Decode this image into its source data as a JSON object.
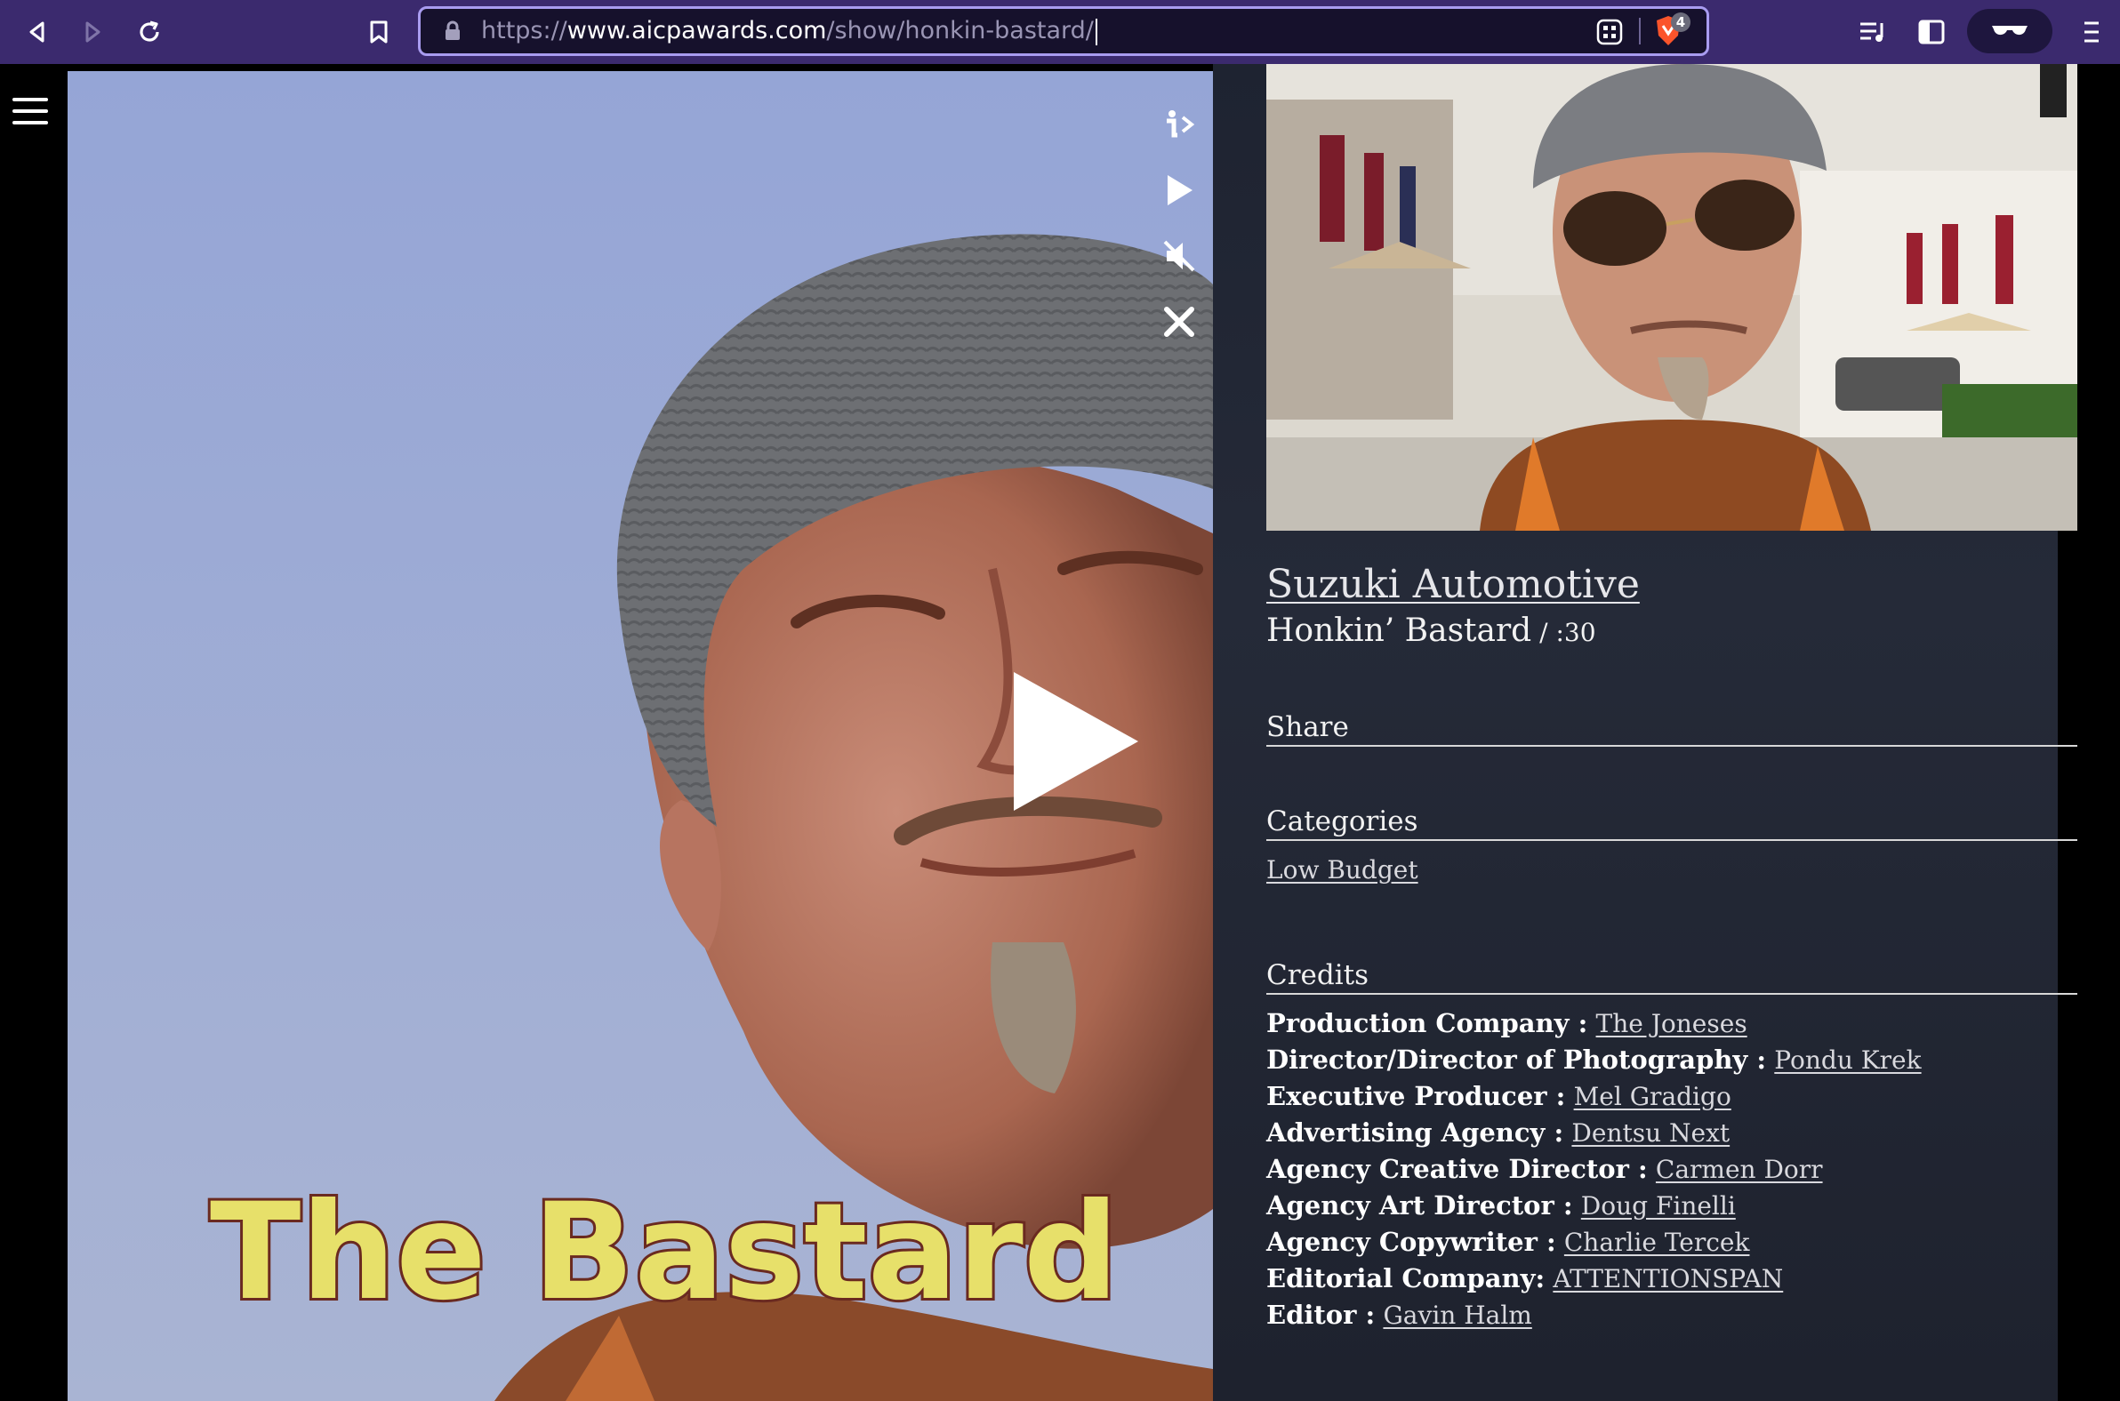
{
  "browser": {
    "url_prefix": "https://",
    "url_domain": "www.aicpawards.com",
    "url_path": "/show/honkin-bastard/",
    "shields_count": "4"
  },
  "video": {
    "caption": "The Bastard"
  },
  "spot": {
    "client": "Suzuki Automotive",
    "title": "Honkin’ Bastard",
    "duration": " / :30"
  },
  "sections": {
    "share": "Share",
    "categories": "Categories",
    "credits": "Credits"
  },
  "categories": [
    "Low Budget"
  ],
  "credits": [
    {
      "role": "Production Company :",
      "name": "The Joneses"
    },
    {
      "role": "Director/Director of Photography :",
      "name": "Pondu Krek"
    },
    {
      "role": "Executive Producer :",
      "name": "Mel Gradigo"
    },
    {
      "role": "Advertising Agency :",
      "name": "Dentsu Next"
    },
    {
      "role": "Agency Creative Director :",
      "name": "Carmen Dorr"
    },
    {
      "role": "Agency Art Director :",
      "name": "Doug Finelli"
    },
    {
      "role": "Agency Copywriter :",
      "name": "Charlie Tercek"
    },
    {
      "role": "Editorial Company:",
      "name": "ATTENTIONSPAN"
    },
    {
      "role": "Editor :",
      "name": "Gavin Halm"
    }
  ],
  "colors": {
    "chrome": "#3b2a6e",
    "urlbar_border": "#a99cf0",
    "panel": "#252a38"
  },
  "icons": [
    "back-icon",
    "forward-icon",
    "reload-icon",
    "bookmark-icon",
    "lock-icon",
    "qr-icon",
    "brave-shields-icon",
    "playlist-icon",
    "sidebar-icon",
    "private-glasses-icon",
    "menu-icon",
    "hamburger-icon",
    "info-icon",
    "play-icon",
    "mute-icon",
    "close-icon"
  ]
}
